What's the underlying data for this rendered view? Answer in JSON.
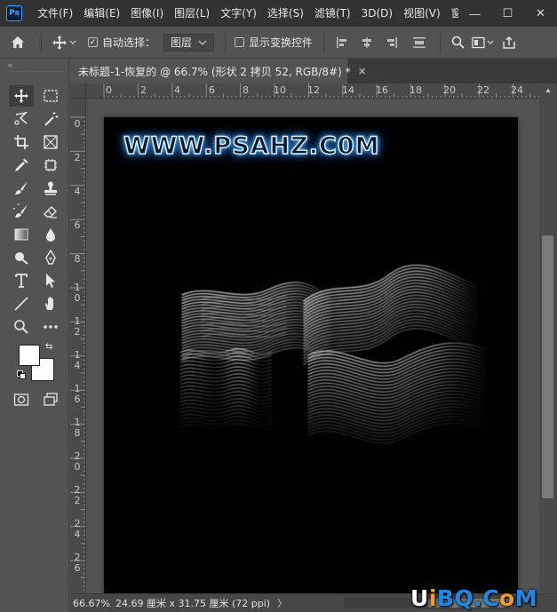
{
  "app": {
    "logo": "Ps",
    "menus": [
      "文件(F)",
      "编辑(E)",
      "图像(I)",
      "图层(L)",
      "文字(Y)",
      "选择(S)",
      "滤镜(T)",
      "3D(D)",
      "视图(V)",
      "窗口(W"
    ],
    "window_controls": {
      "minimize": "—",
      "maximize": "☐",
      "close": "✕"
    }
  },
  "options_bar": {
    "auto_select_label": "自动选择：",
    "auto_select_checked": true,
    "layer_select_value": "图层",
    "show_transform_label": "显示变换控件",
    "show_transform_checked": false
  },
  "toolbar": {
    "collapse_glyph": "«",
    "tools": [
      "move-tool",
      "marquee-tool",
      "lasso-tool",
      "magic-wand-tool",
      "crop-tool",
      "frame-tool",
      "eyedropper-tool",
      "spot-heal-tool",
      "brush-tool",
      "stamp-tool",
      "history-brush-tool",
      "eraser-tool",
      "gradient-tool",
      "blur-tool",
      "dodge-tool",
      "pen-tool",
      "type-tool",
      "path-select-tool",
      "line-tool",
      "hand-tool",
      "zoom-tool",
      "more-tools"
    ],
    "foreground_color": "#ffffff",
    "background_color": "#ffffff"
  },
  "document": {
    "tab_title": "未标题-1-恢复的 @ 66.7% (形状 2 拷贝 52, RGB/8#) *",
    "close_glyph": "×",
    "watermark_text": "WWW.PSAHZ.C0M",
    "artwork": "PS",
    "background": "#000000"
  },
  "rulers": {
    "horizontal": [
      "0",
      "2",
      "4",
      "6",
      "8",
      "10",
      "12",
      "14",
      "16",
      "18",
      "20",
      "22",
      "24"
    ],
    "vertical": [
      "0",
      "2",
      "4",
      "6",
      "8",
      "10",
      "12",
      "14",
      "16",
      "18",
      "20",
      "22",
      "24",
      "26"
    ]
  },
  "status_bar": {
    "zoom": "66.67%",
    "doc_size": "24.69 厘米 x 31.75 厘米 (72 ppi)",
    "arrow": "〉"
  },
  "site_watermark": {
    "part1": "U",
    "part2": "i",
    "part3": "BQ.C",
    "part4": "o",
    "part5": "M"
  },
  "colors": {
    "ui_dark": "#323232",
    "ui_panel": "#535353",
    "glow_blue": "#3aa0ff"
  }
}
